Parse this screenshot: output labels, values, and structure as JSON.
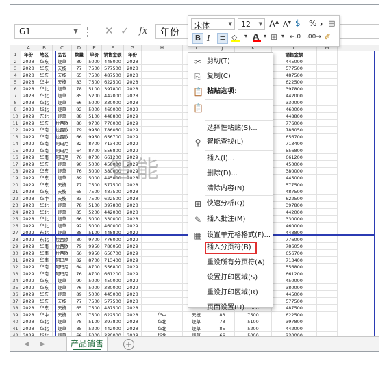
{
  "formula_bar": {
    "name_box": "G1",
    "fx": "fx",
    "cancel": "✕",
    "enter": "✓",
    "content": "年份"
  },
  "columns": [
    "A",
    "B",
    "C",
    "D",
    "E",
    "F",
    "G",
    "H",
    "I",
    "J",
    "K",
    "L",
    "M"
  ],
  "header_row": [
    "年份",
    "地区",
    "品名",
    "数量",
    "单价",
    "销售金额",
    "年份",
    "",
    "",
    "",
    "单价",
    "销售金额"
  ],
  "rows": [
    [
      "2028",
      "华东",
      "烧草",
      "89",
      "5000",
      "445000",
      "2028",
      "",
      "",
      "",
      "5000",
      "445000"
    ],
    [
      "2028",
      "华东",
      "天枝",
      "77",
      "7500",
      "577500",
      "2028",
      "",
      "",
      "",
      "7500",
      "577500"
    ],
    [
      "2028",
      "华东",
      "天枝",
      "65",
      "7500",
      "487500",
      "2028",
      "",
      "",
      "",
      "7500",
      "487500"
    ],
    [
      "2028",
      "华中",
      "天枝",
      "83",
      "7500",
      "622500",
      "2028",
      "",
      "",
      "",
      "7500",
      "622500"
    ],
    [
      "2028",
      "华北",
      "烧草",
      "78",
      "5100",
      "397800",
      "2028",
      "",
      "",
      "",
      "5100",
      "397800"
    ],
    [
      "2028",
      "华北",
      "烧草",
      "85",
      "5200",
      "442000",
      "2028",
      "",
      "",
      "",
      "5200",
      "442000"
    ],
    [
      "2028",
      "华北",
      "烧草",
      "66",
      "5000",
      "330000",
      "2028",
      "",
      "",
      "",
      "5000",
      "330000"
    ],
    [
      "2029",
      "华北",
      "烧草",
      "92",
      "5000",
      "460000",
      "2029",
      "",
      "",
      "",
      "5000",
      "460000"
    ],
    [
      "2029",
      "东北",
      "烧草",
      "88",
      "5100",
      "448800",
      "2029",
      "",
      "",
      "",
      "5100",
      "448800"
    ],
    [
      "2029",
      "华东",
      "拉西欧",
      "80",
      "9700",
      "776000",
      "2029",
      "",
      "",
      "",
      "9700",
      "776000"
    ],
    [
      "2029",
      "华南",
      "拉西欧",
      "79",
      "9950",
      "786050",
      "2029",
      "",
      "",
      "",
      "9950",
      "786050"
    ],
    [
      "2029",
      "华南",
      "拉西欧",
      "66",
      "9950",
      "656700",
      "2029",
      "",
      "",
      "",
      "9950",
      "656700"
    ],
    [
      "2029",
      "华南",
      "阿玛尼",
      "82",
      "8700",
      "713400",
      "2029",
      "",
      "",
      "",
      "8700",
      "713400"
    ],
    [
      "2029",
      "华南",
      "阿玛尼",
      "64",
      "8700",
      "556800",
      "2029",
      "",
      "",
      "",
      "8700",
      "556800"
    ],
    [
      "2029",
      "华南",
      "阿玛尼",
      "76",
      "8700",
      "661200",
      "2029",
      "",
      "",
      "",
      "8700",
      "661200"
    ],
    [
      "2029",
      "华东",
      "烧草",
      "90",
      "5000",
      "450000",
      "2029",
      "",
      "",
      "",
      "5000",
      "450000"
    ],
    [
      "2029",
      "华东",
      "烧草",
      "76",
      "5000",
      "380000",
      "2029",
      "",
      "",
      "",
      "5000",
      "380000"
    ],
    [
      "2029",
      "华东",
      "烧草",
      "89",
      "5000",
      "445000",
      "2028",
      "",
      "",
      "",
      "5000",
      "445000"
    ],
    [
      "2029",
      "华东",
      "天枝",
      "77",
      "7500",
      "577500",
      "2028",
      "",
      "",
      "",
      "7500",
      "577500"
    ],
    [
      "2028",
      "华东",
      "天枝",
      "65",
      "7500",
      "487500",
      "2028",
      "",
      "",
      "",
      "7500",
      "487500"
    ],
    [
      "2028",
      "华中",
      "天枝",
      "83",
      "7500",
      "622500",
      "2028",
      "",
      "",
      "",
      "7500",
      "622500"
    ],
    [
      "2028",
      "华北",
      "烧草",
      "78",
      "5100",
      "397800",
      "2028",
      "",
      "",
      "",
      "5100",
      "397800"
    ],
    [
      "2028",
      "华北",
      "烧草",
      "85",
      "5200",
      "442000",
      "2028",
      "",
      "",
      "",
      "5200",
      "442000"
    ],
    [
      "2028",
      "华北",
      "烧草",
      "66",
      "5000",
      "330000",
      "2028",
      "",
      "",
      "",
      "5000",
      "330000"
    ],
    [
      "2029",
      "华北",
      "烧草",
      "92",
      "5000",
      "460000",
      "2029",
      "",
      "",
      "",
      "5000",
      "460000"
    ],
    [
      "2029",
      "东北",
      "烧草",
      "88",
      "5100",
      "448800",
      "2029",
      "",
      "",
      "",
      "5100",
      "448800"
    ],
    [
      "2029",
      "东北",
      "拉西欧",
      "80",
      "9700",
      "776000",
      "2029",
      "",
      "",
      "",
      "9700",
      "776000"
    ],
    [
      "2029",
      "华南",
      "拉西欧",
      "79",
      "9950",
      "786050",
      "2029",
      "",
      "",
      "",
      "9950",
      "786050"
    ],
    [
      "2029",
      "华南",
      "拉西欧",
      "66",
      "9950",
      "656700",
      "2029",
      "",
      "",
      "",
      "9950",
      "656700"
    ],
    [
      "2029",
      "华南",
      "阿玛尼",
      "82",
      "8700",
      "713400",
      "2029",
      "",
      "",
      "",
      "8700",
      "713400"
    ],
    [
      "2029",
      "华南",
      "阿玛尼",
      "64",
      "8700",
      "556800",
      "2029",
      "",
      "",
      "",
      "8700",
      "556800"
    ],
    [
      "2029",
      "华南",
      "阿玛尼",
      "76",
      "8700",
      "661200",
      "2029",
      "",
      "",
      "",
      "8700",
      "661200"
    ],
    [
      "2029",
      "华东",
      "烧草",
      "90",
      "5000",
      "450000",
      "2029",
      "",
      "",
      "",
      "5000",
      "450000"
    ],
    [
      "2029",
      "华东",
      "烧草",
      "76",
      "5000",
      "380000",
      "2029",
      "",
      "",
      "",
      "5000",
      "380000"
    ],
    [
      "2029",
      "华东",
      "烧草",
      "89",
      "5000",
      "445000",
      "2028",
      "",
      "",
      "",
      "5000",
      "445000"
    ],
    [
      "2029",
      "华东",
      "天枝",
      "77",
      "7500",
      "577500",
      "2028",
      "",
      "",
      "",
      "7500",
      "577500"
    ],
    [
      "2028",
      "华东",
      "天枝",
      "65",
      "7500",
      "487500",
      "2028",
      "",
      "",
      "",
      "7500",
      "487500"
    ],
    [
      "2028",
      "华中",
      "天枝",
      "83",
      "7500",
      "622500",
      "2028",
      "华中",
      "天枝",
      "83",
      "7500",
      "622500"
    ],
    [
      "2028",
      "华北",
      "烧草",
      "78",
      "5100",
      "397800",
      "2028",
      "华北",
      "烧草",
      "78",
      "5100",
      "397800"
    ],
    [
      "2028",
      "华北",
      "烧草",
      "85",
      "5200",
      "442000",
      "2028",
      "华北",
      "烧草",
      "85",
      "5200",
      "442000"
    ],
    [
      "2028",
      "华北",
      "烧草",
      "66",
      "5000",
      "330000",
      "2028",
      "华北",
      "烧草",
      "66",
      "5000",
      "330000"
    ]
  ],
  "watermark": "智能",
  "sheet_tabs": {
    "prev": "◀",
    "next": "▶",
    "active": "产品销售",
    "add": "+"
  },
  "mini_toolbar": {
    "font_name": "宋体",
    "font_size": "12",
    "grow_font": "A",
    "shrink_font": "A",
    "currency": "$",
    "percent": "%",
    "comma": ",",
    "bold": "B",
    "italic": "I",
    "fill_color": "#ffff00",
    "font_color": "#ff0000"
  },
  "context_menu": {
    "items": [
      {
        "label": "剪切(T)",
        "icon": "scissors-icon",
        "glyph": "✂"
      },
      {
        "label": "复制(C)",
        "icon": "copy-icon",
        "glyph": "⎘"
      },
      {
        "label": "粘贴选项:",
        "icon": "paste-icon",
        "glyph": "📋"
      },
      {
        "label": "",
        "icon": "paste-option-icon",
        "glyph": "📋"
      },
      {
        "label": "选择性粘贴(S)...",
        "icon": "",
        "glyph": ""
      },
      {
        "label": "智能查找(L)",
        "icon": "smart-lookup-icon",
        "glyph": "⚲"
      },
      {
        "label": "插入(I)...",
        "icon": "",
        "glyph": ""
      },
      {
        "label": "删除(D)...",
        "icon": "",
        "glyph": ""
      },
      {
        "label": "清除内容(N)",
        "icon": "",
        "glyph": ""
      },
      {
        "label": "快速分析(Q)",
        "icon": "quick-analysis-icon",
        "glyph": "⊞"
      },
      {
        "label": "插入批注(M)",
        "icon": "insert-comment-icon",
        "glyph": "✎"
      },
      {
        "label": "设置单元格格式(F)...",
        "icon": "format-cells-icon",
        "glyph": "▦"
      },
      {
        "label": "插入分页符(B)",
        "icon": "",
        "glyph": ""
      },
      {
        "label": "重设所有分页符(A)",
        "icon": "",
        "glyph": ""
      },
      {
        "label": "设置打印区域(S)",
        "icon": "",
        "glyph": ""
      },
      {
        "label": "重设打印区域(R)",
        "icon": "",
        "glyph": ""
      },
      {
        "label": "页面设置(U)...",
        "icon": "",
        "glyph": ""
      }
    ]
  }
}
